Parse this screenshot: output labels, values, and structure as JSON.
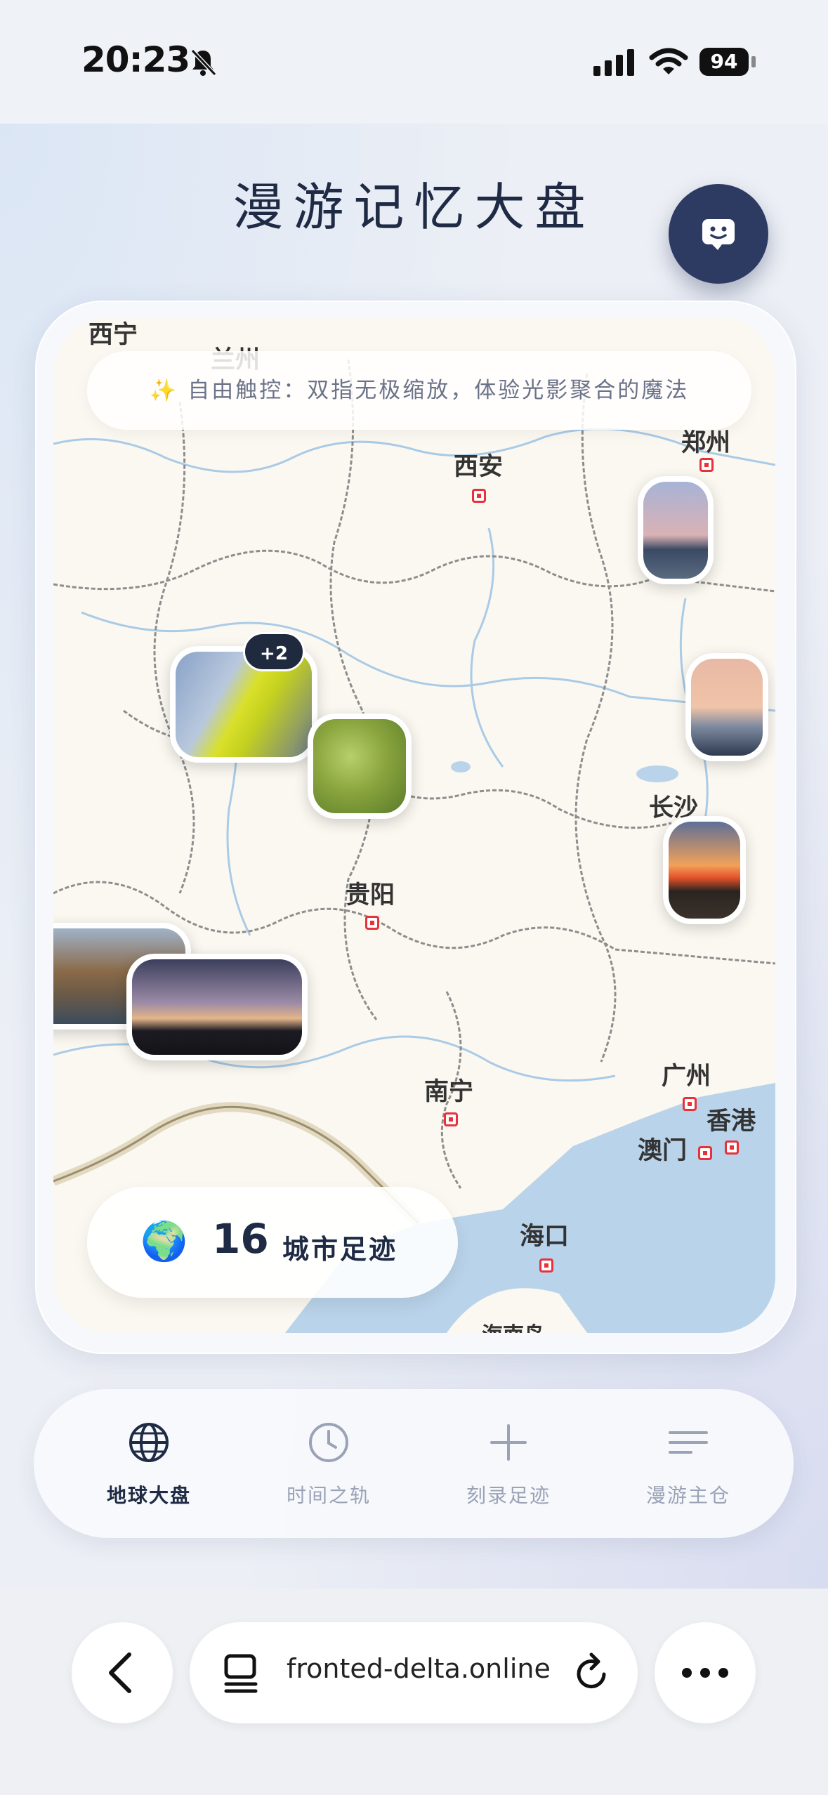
{
  "status": {
    "time": "20:23",
    "battery": "94"
  },
  "app": {
    "title": "漫游记忆大盘"
  },
  "map": {
    "hint": "✨  自由触控：双指无极缩放，体验光影聚合的魔法",
    "cities": [
      {
        "name": "西宁"
      },
      {
        "name": "兰州"
      },
      {
        "name": "郑州"
      },
      {
        "name": "西安"
      },
      {
        "name": "长沙"
      },
      {
        "name": "贵阳"
      },
      {
        "name": "南宁"
      },
      {
        "name": "广州"
      },
      {
        "name": "香港"
      },
      {
        "name": "澳门"
      },
      {
        "name": "海口"
      },
      {
        "name": "海南岛"
      }
    ],
    "cluster_badge": "+2",
    "footprint": {
      "globe": "🌍",
      "count": "16",
      "label": "城市足迹"
    }
  },
  "tabs": [
    {
      "label": "地球大盘",
      "icon": "globe-icon",
      "active": true
    },
    {
      "label": "时间之轨",
      "icon": "clock-icon",
      "active": false
    },
    {
      "label": "刻录足迹",
      "icon": "plus-icon",
      "active": false
    },
    {
      "label": "漫游主仓",
      "icon": "menu-icon",
      "active": false
    }
  ],
  "browser": {
    "url": "fronted-delta.online"
  },
  "colors": {
    "accent": "#2d3b63",
    "city_marker": "#e8323a",
    "water": "#b9d3ea",
    "land": "#fbf8f1"
  }
}
